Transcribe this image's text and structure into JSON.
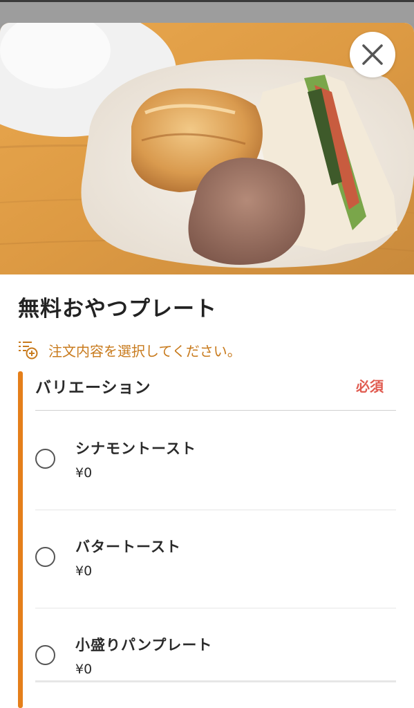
{
  "product": {
    "title": "無料おやつプレート",
    "image_alt": "food-photo"
  },
  "hint": {
    "text": "注文内容を選択してください。",
    "icon": "list-add-icon",
    "color": "#c87a1c"
  },
  "variation": {
    "heading": "バリエーション",
    "required_label": "必須",
    "accent_color": "#e57f1a",
    "required_color": "#e05a4f",
    "options": [
      {
        "name": "シナモントースト",
        "price": "¥0",
        "selected": false
      },
      {
        "name": "バタートースト",
        "price": "¥0",
        "selected": false
      },
      {
        "name": "小盛りパンプレート",
        "price": "¥0",
        "selected": false
      }
    ]
  },
  "controls": {
    "close_icon": "close-icon"
  }
}
